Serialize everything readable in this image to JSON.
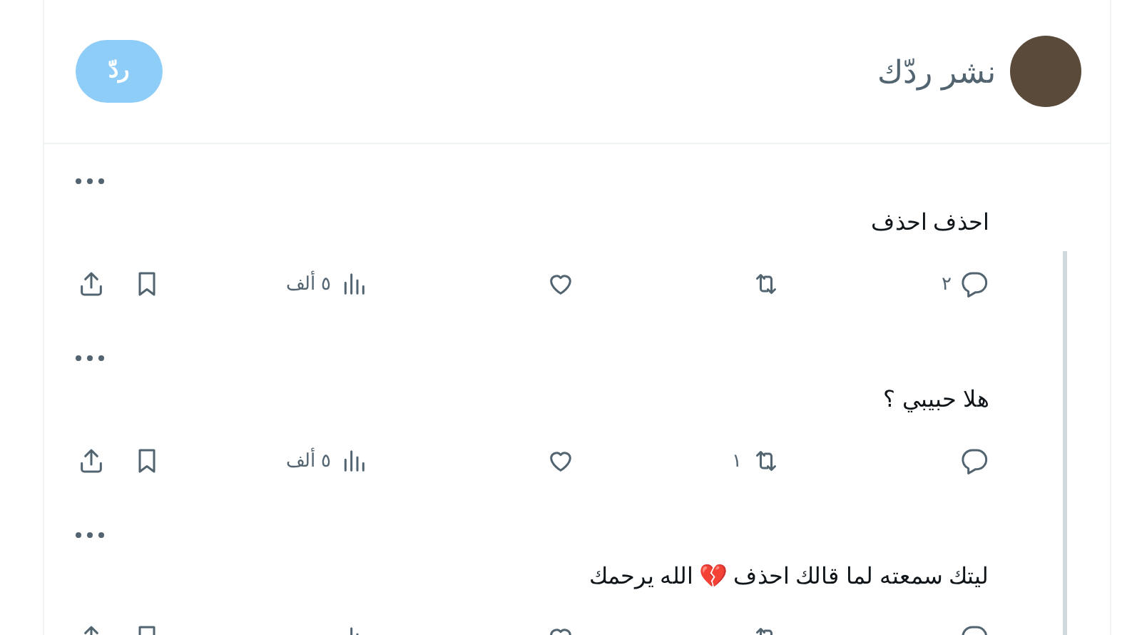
{
  "composer": {
    "placeholder": "نشر ردّك",
    "button": {
      "label": "ردّ",
      "disabled": true
    }
  },
  "tweets": [
    {
      "text": "احذف احذف",
      "thread_from_above": false,
      "stats": {
        "replies": "٢",
        "views": "٥ ألف"
      }
    },
    {
      "text": "هلا حبيبي ؟",
      "thread_from_above": true,
      "stats": {
        "retweets": "١",
        "views": "٥ ألف"
      }
    },
    {
      "text": "ليتك سمعته لما قالك احذف 💔 الله يرحمك",
      "thread_from_above": true
    }
  ]
}
